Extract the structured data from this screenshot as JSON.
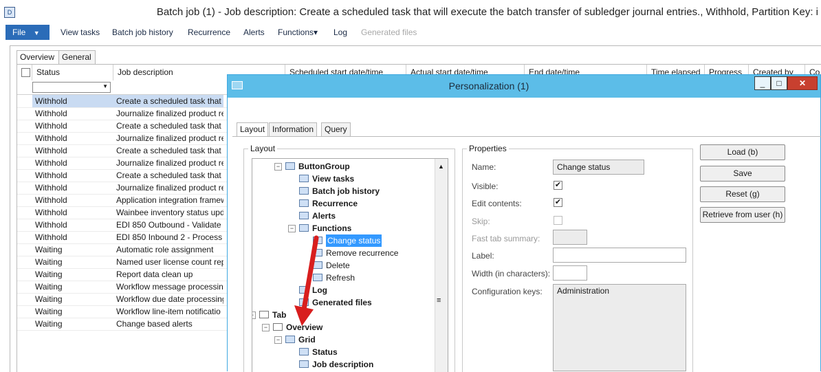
{
  "window": {
    "title": "Batch job (1) - Job description: Create a scheduled task that will execute the batch transfer of subledger journal entries., Withhold, Partition Key: i",
    "app_icon": "app-icon"
  },
  "menu": {
    "file": "File",
    "items": [
      "View tasks",
      "Batch job history",
      "Recurrence",
      "Alerts",
      "Functions▾",
      "Log",
      "Generated files"
    ]
  },
  "tabs": [
    "Overview",
    "General"
  ],
  "grid": {
    "columns": [
      "Status",
      "Job description",
      "Scheduled start date/time",
      "Actual start date/time",
      "End date/time",
      "Time elapsed",
      "Progress",
      "Created by",
      "Co"
    ],
    "rows": [
      {
        "status": "Withhold",
        "desc": "Create a scheduled task that w"
      },
      {
        "status": "Withhold",
        "desc": "Journalize finalized product re"
      },
      {
        "status": "Withhold",
        "desc": "Create a scheduled task that w"
      },
      {
        "status": "Withhold",
        "desc": "Journalize finalized product re"
      },
      {
        "status": "Withhold",
        "desc": "Create a scheduled task that w"
      },
      {
        "status": "Withhold",
        "desc": "Journalize finalized product re"
      },
      {
        "status": "Withhold",
        "desc": "Create a scheduled task that w"
      },
      {
        "status": "Withhold",
        "desc": "Journalize finalized product re"
      },
      {
        "status": "Withhold",
        "desc": "Application integration framew"
      },
      {
        "status": "Withhold",
        "desc": "Wainbee inventory status upd"
      },
      {
        "status": "Withhold",
        "desc": "EDI 850 Outbound - Validate a"
      },
      {
        "status": "Withhold",
        "desc": "EDI 850 Inbound 2 - Process (1"
      },
      {
        "status": "Waiting",
        "desc": "Automatic role assignment"
      },
      {
        "status": "Waiting",
        "desc": "Named user license count rep"
      },
      {
        "status": "Waiting",
        "desc": "Report data clean up"
      },
      {
        "status": "Waiting",
        "desc": "Workflow message processing"
      },
      {
        "status": "Waiting",
        "desc": "Workflow due date processing"
      },
      {
        "status": "Waiting",
        "desc": "Workflow line-item notificatio"
      },
      {
        "status": "Waiting",
        "desc": "Change based alerts"
      }
    ]
  },
  "dialog": {
    "title": "Personalization (1)",
    "tabs": [
      "Layout",
      "Information",
      "Query"
    ],
    "layout_group": "Layout",
    "properties_group": "Properties",
    "tree": [
      {
        "label": "ButtonGroup",
        "bold": true
      },
      {
        "label": "View tasks",
        "bold": true
      },
      {
        "label": "Batch job history",
        "bold": true
      },
      {
        "label": "Recurrence",
        "bold": true
      },
      {
        "label": "Alerts",
        "bold": true
      },
      {
        "label": "Functions",
        "bold": true
      },
      {
        "label": "Change status",
        "bold": false
      },
      {
        "label": "Remove recurrence",
        "bold": false
      },
      {
        "label": "Delete",
        "bold": false
      },
      {
        "label": "Refresh",
        "bold": false
      },
      {
        "label": "Log",
        "bold": true
      },
      {
        "label": "Generated files",
        "bold": true
      },
      {
        "label": "Tab",
        "bold": true
      },
      {
        "label": "Overview",
        "bold": true
      },
      {
        "label": "Grid",
        "bold": true
      },
      {
        "label": "Status",
        "bold": true
      },
      {
        "label": "Job description",
        "bold": true
      }
    ],
    "props": {
      "name_label": "Name:",
      "name_value": "Change status",
      "visible_label": "Visible:",
      "visible_checked": true,
      "edit_label": "Edit contents:",
      "edit_checked": true,
      "skip_label": "Skip:",
      "skip_checked": false,
      "fasttab_label": "Fast tab summary:",
      "label_label": "Label:",
      "width_label": "Width (in characters):",
      "config_label": "Configuration keys:",
      "config_value": "Administration"
    },
    "buttons": [
      "Load (b)",
      "Save",
      "Reset (g)",
      "Retrieve from user (h)"
    ],
    "annotation_color": "#d81e1e",
    "accent": "#5cbde8"
  }
}
